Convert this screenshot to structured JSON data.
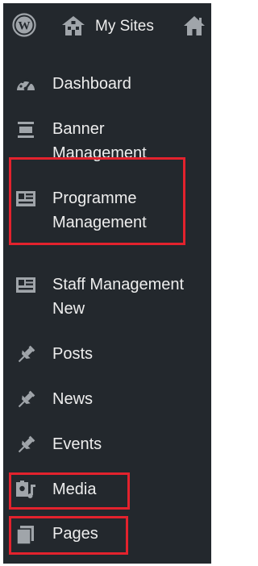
{
  "topbar": {
    "wp_logo_icon": "wordpress-logo-icon",
    "my_sites_icon": "my-sites-icon",
    "my_sites_label": "My Sites",
    "home_icon": "home-icon"
  },
  "menu": {
    "items": [
      {
        "label": "Dashboard",
        "icon": "dashboard-icon",
        "highlighted": false
      },
      {
        "label_line1": "Banner",
        "label_line2": "Management",
        "icon": "banner-icon",
        "highlighted": false
      },
      {
        "label_line1": "Programme",
        "label_line2": "Management",
        "icon": "id-card-icon",
        "highlighted": true
      },
      {
        "label_line1": "Staff Management",
        "label_line2": "New",
        "icon": "id-card-icon",
        "highlighted": false
      },
      {
        "label": "Posts",
        "icon": "pin-icon",
        "highlighted": false
      },
      {
        "label": "News",
        "icon": "pin-icon",
        "highlighted": false
      },
      {
        "label": "Events",
        "icon": "pin-icon",
        "highlighted": false
      },
      {
        "label": "Media",
        "icon": "media-icon",
        "highlighted": true
      },
      {
        "label": "Pages",
        "icon": "pages-icon",
        "highlighted": true
      }
    ]
  },
  "colors": {
    "sidebar_bg": "#23282d",
    "text": "#eeeeee",
    "icon": "#a0a5aa",
    "highlight": "#e3222d"
  }
}
